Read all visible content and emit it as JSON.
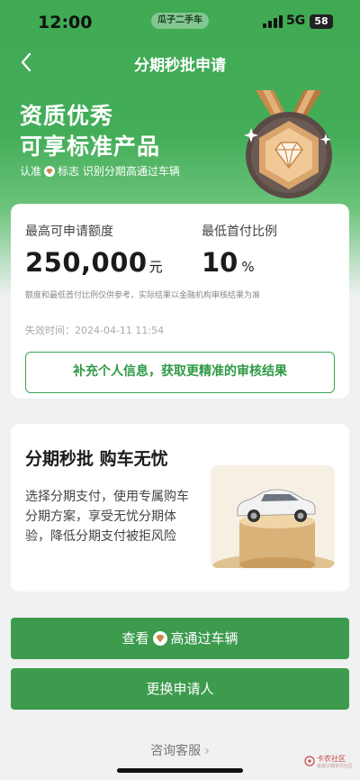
{
  "status_bar": {
    "time": "12:00",
    "carrier_pill": "瓜子二手车",
    "network": "5G",
    "battery": "58",
    "icons": [
      "signal-icon",
      "battery-icon"
    ]
  },
  "nav": {
    "title": "分期秒批申请",
    "back_icon": "back-chevron-icon"
  },
  "hero": {
    "title_line1": "资质优秀",
    "title_line2": "可享标准产品",
    "subtitle_pre": "认准",
    "subtitle_post": "标志 识别分期高通过车辆",
    "badge_icon": "medal-diamond-icon"
  },
  "quota_card": {
    "max_label": "最高可申请额度",
    "max_value": "250,000",
    "max_unit": "元",
    "ratio_label": "最低首付比例",
    "ratio_value": "10",
    "ratio_unit": "%",
    "disclaimer": "额度和最低首付比例仅供参考，实际结果以金融机构审核结果为准",
    "expiry": "失效时间：2024-04-11 11:54",
    "supplement_button": "补充个人信息，获取更精准的审核结果"
  },
  "promo_card": {
    "title": "分期秒批 购车无忧",
    "description": "选择分期支付，使用专属购车分期方案，享受无忧分期体验，降低分期支付被拒风险",
    "image_icon": "car-on-podium-image"
  },
  "actions": {
    "view_pre": "查看",
    "view_post": "高通过车辆",
    "change_applicant": "更换申请人",
    "service": "咨询客服",
    "service_chevron": "›"
  },
  "watermark": {
    "text": "卡农社区",
    "sub": "金融分期资讯社区"
  },
  "colors": {
    "brand_green": "#3fa954",
    "button_green": "#3d9b4e",
    "outline_green": "#3da453",
    "medal_gold": "#d9a56c"
  }
}
